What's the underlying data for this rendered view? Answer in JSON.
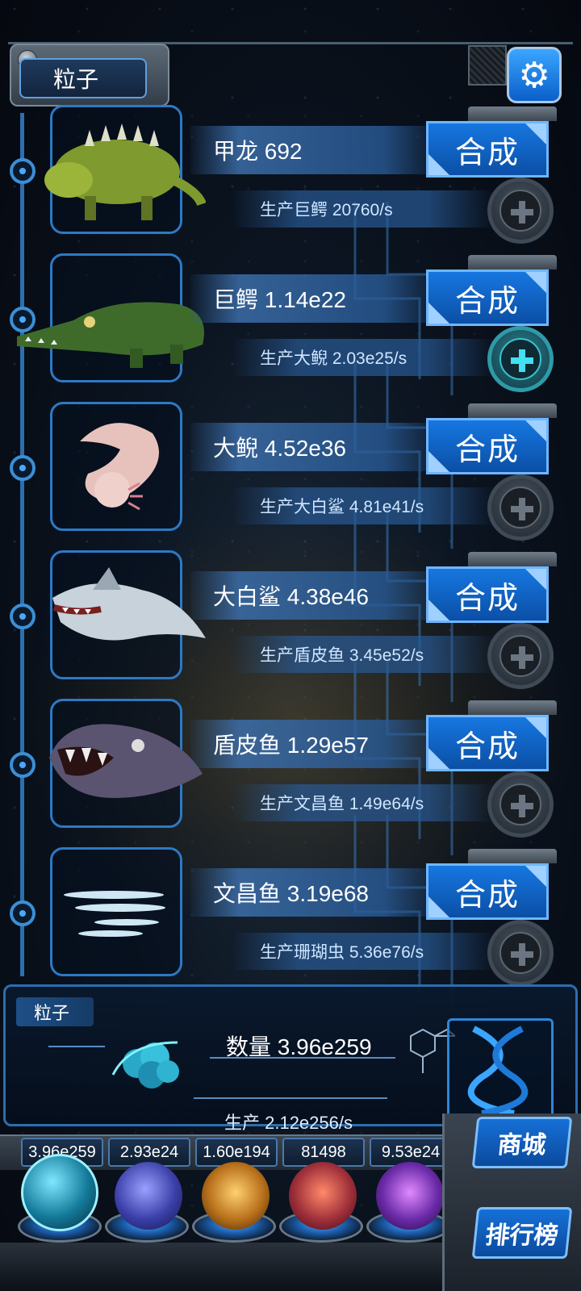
{
  "header": {
    "tab_label": "粒子",
    "settings_icon": "gear-icon"
  },
  "creatures": [
    {
      "name": "甲龙 692",
      "produce": "生产巨鳄 20760/s",
      "merge_label": "合成",
      "plus_active": false,
      "image": "ankylosaurus"
    },
    {
      "name": "巨鳄 1.14e22",
      "produce": "生产大鲵 2.03e25/s",
      "merge_label": "合成",
      "plus_active": true,
      "image": "crocodile"
    },
    {
      "name": "大鲵 4.52e36",
      "produce": "生产大白鲨 4.81e41/s",
      "merge_label": "合成",
      "plus_active": false,
      "image": "axolotl"
    },
    {
      "name": "大白鲨 4.38e46",
      "produce": "生产盾皮鱼 3.45e52/s",
      "merge_label": "合成",
      "plus_active": false,
      "image": "great-white-shark"
    },
    {
      "name": "盾皮鱼 1.29e57",
      "produce": "生产文昌鱼 1.49e64/s",
      "merge_label": "合成",
      "plus_active": false,
      "image": "dunkleosteus"
    },
    {
      "name": "文昌鱼 3.19e68",
      "produce": "生产珊瑚虫 5.36e76/s",
      "merge_label": "合成",
      "plus_active": false,
      "image": "lancelet"
    }
  ],
  "particle_panel": {
    "tab_label": "粒子",
    "quantity": "数量 3.96e259",
    "production": "生产 2.12e256/s"
  },
  "resources": [
    {
      "value": "3.96e259",
      "orb": "particle-orb"
    },
    {
      "value": "2.93e24",
      "orb": "lightning-orb"
    },
    {
      "value": "1.60e194",
      "orb": "fire-orb"
    },
    {
      "value": "81498",
      "orb": "brain-orb"
    },
    {
      "value": "9.53e24",
      "orb": "vortex-orb"
    }
  ],
  "side_buttons": {
    "shop": "商城",
    "ranking": "排行榜"
  },
  "colors": {
    "accent": "#1677e0",
    "frame": "#2d79c4",
    "active_plus": "#42e0f0"
  }
}
